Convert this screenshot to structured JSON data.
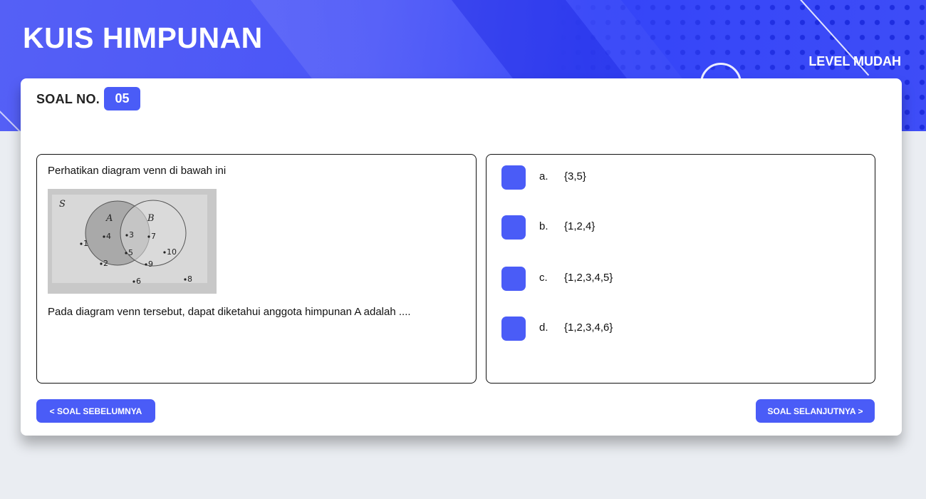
{
  "header": {
    "title": "KUIS HIMPUNAN",
    "level": "LEVEL MUDAH"
  },
  "question": {
    "label": "SOAL NO.",
    "number": "05",
    "intro": "Perhatikan diagram venn di bawah ini",
    "text": "Pada diagram venn tersebut, dapat diketahui anggota himpunan A adalah ....",
    "venn": {
      "universe_label": "S",
      "set_a_label": "A",
      "set_b_label": "B",
      "elements": [
        "1",
        "4",
        "3",
        "7",
        "5",
        "10",
        "2",
        "9",
        "6",
        "8"
      ]
    }
  },
  "options": [
    {
      "letter": "a.",
      "text": "{3,5}"
    },
    {
      "letter": "b.",
      "text": "{1,2,4}"
    },
    {
      "letter": "c.",
      "text": "{1,2,3,4,5}"
    },
    {
      "letter": "d.",
      "text": "{1,2,3,4,6}"
    }
  ],
  "nav": {
    "prev_label": "< SOAL SEBELUMNYA",
    "next_label": "SOAL SELANJUTNYA >"
  },
  "colors": {
    "accent": "#4a5cf7",
    "header_blue": "#3444f8",
    "background": "#eaedf2"
  }
}
